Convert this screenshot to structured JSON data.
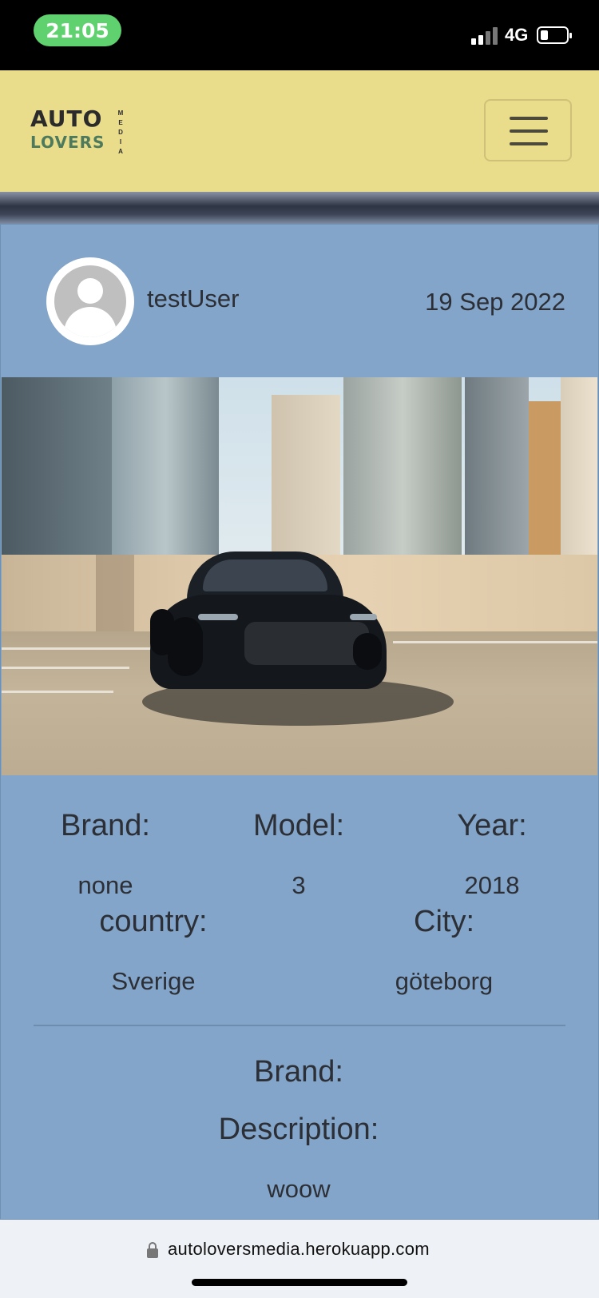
{
  "status_bar": {
    "time": "21:05",
    "network": "4G",
    "icons": [
      "signal-icon",
      "battery-icon"
    ]
  },
  "navbar": {
    "logo_top": "AUTO",
    "logo_bottom": "LOVERS",
    "logo_side": "MEDIA",
    "menu_icon": "hamburger-menu-icon"
  },
  "post": {
    "username": "testUser",
    "date": "19 Sep 2022",
    "avatar_icon": "default-avatar-icon",
    "details": {
      "brand_label": "Brand:",
      "brand_value": "none",
      "model_label": "Model:",
      "model_value": "3",
      "year_label": "Year:",
      "year_value": "2018",
      "country_label": "country:",
      "country_value": "Sverige",
      "city_label": "City:",
      "city_value": "göteborg"
    },
    "lower": {
      "brand_label": "Brand:",
      "description_label": "Description:",
      "description_value": "woow"
    }
  },
  "browser": {
    "url": "autoloversmedia.herokuapp.com",
    "lock_icon": "lock-icon"
  }
}
